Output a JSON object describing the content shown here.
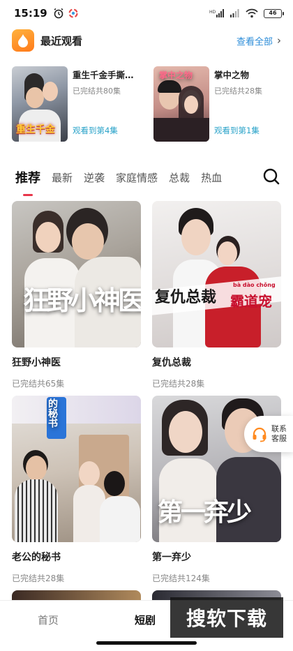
{
  "status_bar": {
    "time": "15:19",
    "battery": "46"
  },
  "recent": {
    "title": "最近观看",
    "view_all": "查看全部",
    "items": [
      {
        "name": "重生千金手撕…",
        "meta": "已完结共80集",
        "progress": "观看到第4集",
        "poster_text": "重生千金"
      },
      {
        "name": "掌中之物",
        "meta": "已完结共28集",
        "progress": "观看到第1集",
        "poster_text": "掌中之物"
      }
    ]
  },
  "tabs": [
    "推荐",
    "最新",
    "逆袭",
    "家庭情感",
    "总裁",
    "热血"
  ],
  "dramas": [
    {
      "title": "狂野小神医",
      "meta": "已完结共65集",
      "poster_text": "狂野小神医"
    },
    {
      "title": "复仇总裁",
      "meta": "已完结共28集",
      "poster_text": "复仇总裁",
      "poster_sub": "霸道宠",
      "poster_pinyin": "bà  dào  chǒng"
    },
    {
      "title": "老公的秘书",
      "meta": "已完结共28集",
      "poster_text": "的秘书"
    },
    {
      "title": "第一弃少",
      "meta": "已完结共124集",
      "poster_text": "第一弃少"
    }
  ],
  "floating_service": {
    "label": "联系客服"
  },
  "bottom_nav": {
    "home": "首页",
    "drama": "短剧"
  },
  "watermark": "搜软下载",
  "colors": {
    "accent_red": "#e8364a",
    "link_blue": "#2b8cd8",
    "progress_teal": "#2aa3c9",
    "logo_orange": "#ff8a1f"
  }
}
